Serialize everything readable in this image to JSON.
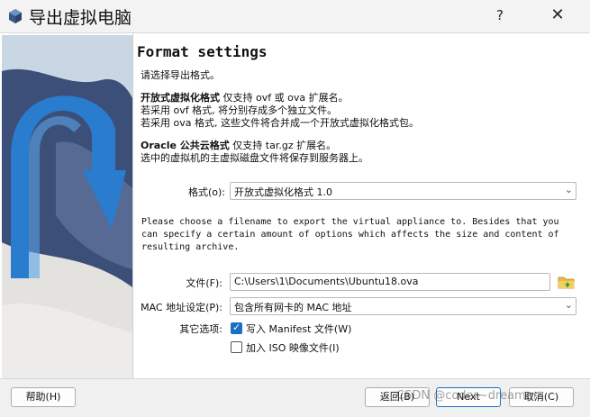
{
  "window": {
    "title": "导出虚拟电脑",
    "help_symbol": "?",
    "close_symbol": "✕"
  },
  "page": {
    "title": "Format settings",
    "prompt": "请选择导出格式。",
    "ovf_heading": "开放式虚拟化格式",
    "ovf_desc": "仅支持 ovf 或 ova 扩展名。",
    "ovf_line1": "若采用 ovf 格式, 将分别存成多个独立文件。",
    "ovf_line2": "若采用 ova 格式, 这些文件将合并成一个开放式虚拟化格式包。",
    "oracle_heading": "Oracle 公共云格式",
    "oracle_desc": "仅支持 tar.gz 扩展名。",
    "oracle_line1": "选中的虚拟机的主虚拟磁盘文件将保存到服务器上。",
    "format_label": "格式(o):",
    "format_value": "开放式虚拟化格式 1.0",
    "info_line1": "Please choose a filename to export the virtual appliance to. Besides that you",
    "info_line2": "can specify a certain amount of options which affects the size and content of",
    "info_line3": "resulting archive.",
    "file_label": "文件(F):",
    "file_value": "C:\\Users\\1\\Documents\\Ubuntu18.ova",
    "mac_label": "MAC 地址设定(P):",
    "mac_value": "包含所有网卡的 MAC 地址",
    "other_label": "其它选项:",
    "manifest_label": "写入 Manifest 文件(W)",
    "manifest_checked": true,
    "iso_label": "加入 ISO 映像文件(I)",
    "iso_checked": false
  },
  "buttons": {
    "help": "帮助(H)",
    "back": "返回(B)",
    "next": "Next",
    "cancel": "取消(C)"
  },
  "watermark": "CSDN @coder~dreamer",
  "colors": {
    "accent": "#1b6fc4",
    "arrow": "#2a7ccf"
  }
}
